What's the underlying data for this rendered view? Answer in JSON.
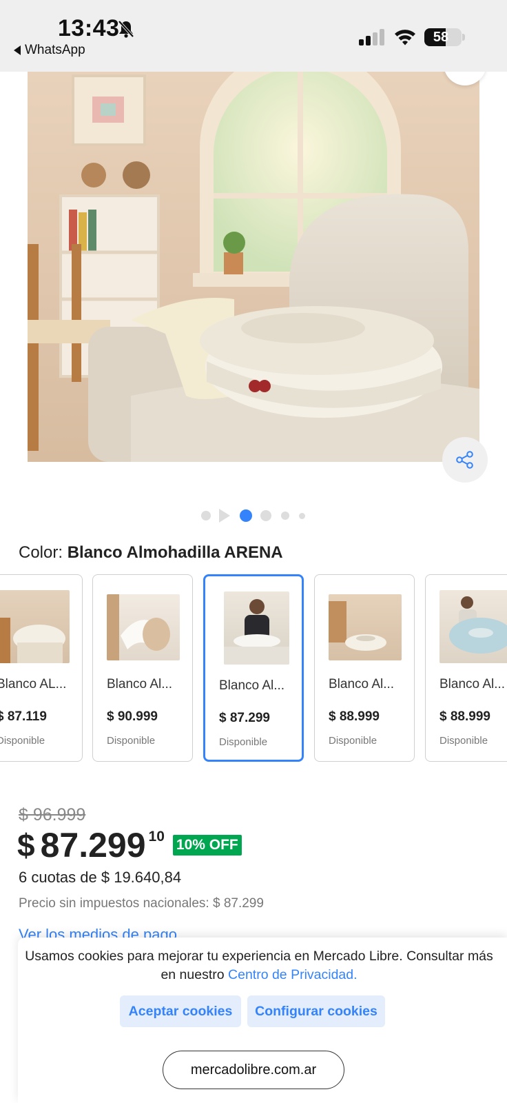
{
  "status_bar": {
    "time": "13:43",
    "back_label": "WhatsApp",
    "battery": "58",
    "battery_level": 0.58
  },
  "gallery": {
    "image_count": 5,
    "active_index": 1
  },
  "color_selector": {
    "label": "Color:",
    "selected": "Blanco Almohadilla ARENA"
  },
  "variants": [
    {
      "name": "Blanco AL...",
      "price": "$ 87.119",
      "status": "Disponible"
    },
    {
      "name": "Blanco Al...",
      "price": "$ 90.999",
      "status": "Disponible"
    },
    {
      "name": "Blanco Al...",
      "price": "$ 87.299",
      "status": "Disponible",
      "selected": true
    },
    {
      "name": "Blanco Al...",
      "price": "$ 88.999",
      "status": "Disponible"
    },
    {
      "name": "Blanco Al...",
      "price": "$ 88.999",
      "status": "Disponible"
    }
  ],
  "pricing": {
    "original": "$ 96.999",
    "currency": "$",
    "amount": "87.299",
    "cents": "10",
    "discount": "10% OFF",
    "installments": "6 cuotas de $ 19.640,84",
    "tax_note": "Precio sin impuestos nacionales: $ 87.299",
    "payment_link": "Ver los medios de pago"
  },
  "cookie_banner": {
    "text": "Usamos cookies para mejorar tu experiencia en Mercado Libre. Consultar más en nuestro",
    "link": "Centro de Privacidad.",
    "accept": "Aceptar cookies",
    "configure": "Configurar cookies"
  },
  "browser": {
    "url": "mercadolibre.com.ar"
  },
  "colors": {
    "accent": "#3483fa",
    "discount_bg": "#00a650",
    "button_bg": "#e3edfb"
  }
}
